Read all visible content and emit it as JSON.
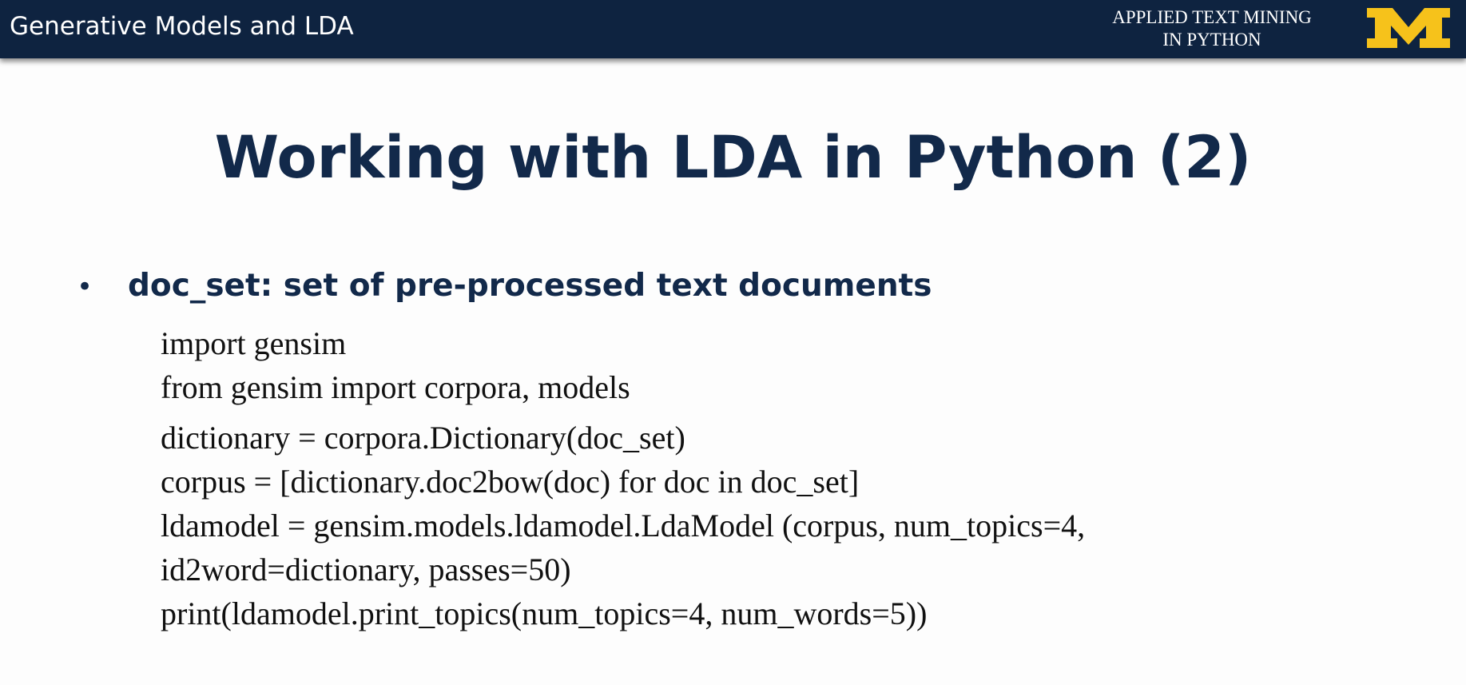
{
  "header": {
    "section_title": "Generative Models and LDA",
    "course_line1": "APPLIED TEXT MINING",
    "course_line2": "IN PYTHON",
    "logo_letter": "M",
    "logo_color": "#f6c21b",
    "bar_color": "#0e2340"
  },
  "slide": {
    "title": "Working with LDA in Python (2)",
    "bullet": "doc_set: set of pre-processed text documents",
    "code_lines": [
      "import gensim",
      "from gensim import corpora, models",
      "dictionary = corpora.Dictionary(doc_set)",
      "corpus = [dictionary.doc2bow(doc) for doc in doc_set]",
      "ldamodel = gensim.models.ldamodel.LdaModel (corpus, num_topics=4,",
      "id2word=dictionary, passes=50)",
      "print(ldamodel.print_topics(num_topics=4, num_words=5))"
    ]
  }
}
